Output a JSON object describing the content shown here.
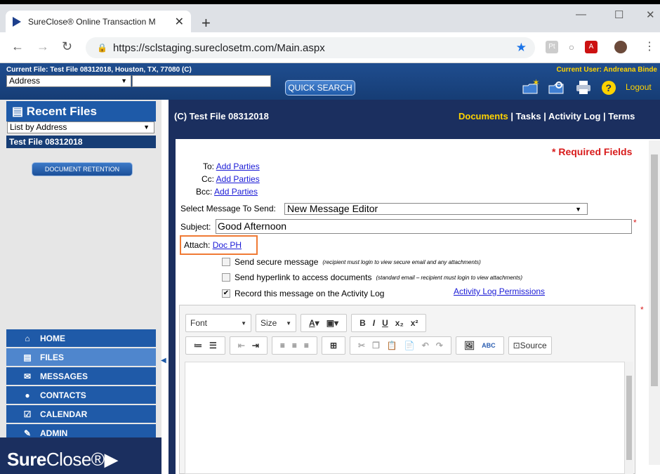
{
  "browser": {
    "tab_title": "SureClose® Online Transaction M",
    "url": "https://sclstaging.sureclosetm.com/Main.aspx"
  },
  "header": {
    "current_file": "Current File:  Test File 08312018, Houston, TX, 77080 (C)",
    "current_user": "Current User:  Andreana Binde",
    "search_type": "Address",
    "search_value": "",
    "quick_search_label": "QUICK SEARCH",
    "logout_label": "Logout"
  },
  "sidebar": {
    "recent_files_title": "Recent Files",
    "list_by": "List by Address",
    "recent_items": [
      "Test File 08312018"
    ],
    "document_retention_label": "DOCUMENT RETENTION",
    "nav": [
      {
        "label": "HOME",
        "icon": "home-icon"
      },
      {
        "label": "FILES",
        "icon": "files-icon"
      },
      {
        "label": "MESSAGES",
        "icon": "envelope-icon"
      },
      {
        "label": "CONTACTS",
        "icon": "contacts-icon"
      },
      {
        "label": "CALENDAR",
        "icon": "calendar-check-icon"
      },
      {
        "label": "ADMIN",
        "icon": "wrench-icon"
      }
    ],
    "brand_bold": "Sure",
    "brand_rest": "Close®"
  },
  "main": {
    "title": "(C) Test File 08312018",
    "tabs": {
      "documents": "Documents",
      "tasks": "Tasks",
      "activity_log": "Activity Log",
      "terms": "Terms"
    },
    "required_note": "* Required Fields",
    "to_label": "To:",
    "cc_label": "Cc:",
    "bcc_label": "Bcc:",
    "add_parties": "Add Parties",
    "select_message_label": "Select Message To Send:",
    "select_message_value": "New Message Editor",
    "subject_label": "Subject:",
    "subject_value": "Good Afternoon",
    "attach_label": "Attach:",
    "attach_link": "Doc PH",
    "options": {
      "secure_label": "Send secure message",
      "secure_note": "(recipient must login to view secure email and any attachments)",
      "hyperlink_label": "Send hyperlink to access documents",
      "hyperlink_note": "(standard email – recipient must login to view attachments)",
      "record_label": "Record this message on the Activity Log",
      "record_checked": true
    },
    "activity_permissions": "Activity Log Permissions"
  },
  "editor": {
    "font_label": "Font",
    "size_label": "Size",
    "source_label": "Source"
  },
  "colors": {
    "navy": "#1b2f5f",
    "blue": "#1f5aa8",
    "yellow": "#ffd300",
    "required_red": "#d81b1b",
    "highlight_orange": "#f07a34"
  }
}
